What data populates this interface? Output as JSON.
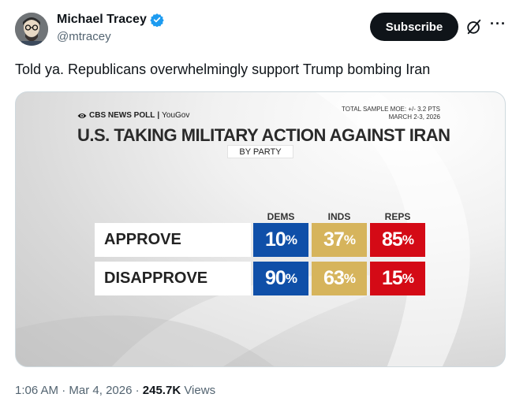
{
  "author": {
    "name": "Michael Tracey",
    "handle": "@mtracey",
    "verified": true,
    "avatar_icon": "avatar-caricature-icon"
  },
  "actions": {
    "subscribe_label": "Subscribe",
    "grok_icon": "grok-icon",
    "more_label": "···"
  },
  "tweet": {
    "text": "Told ya. Republicans overwhelmingly support Trump bombing Iran"
  },
  "poll_graphic": {
    "source": "CBS NEWS POLL",
    "partner": "YouGov",
    "moe_line1": "TOTAL SAMPLE MOE: +/- 3.2 PTS",
    "moe_line2": "MARCH 2-3, 2026",
    "title": "U.S. TAKING MILITARY ACTION AGAINST IRAN",
    "subtitle": "BY PARTY",
    "columns": [
      "DEMS",
      "INDS",
      "REPS"
    ],
    "column_colors": [
      "#0f4fa8",
      "#d6b45c",
      "#d40a16"
    ],
    "rows": [
      {
        "label": "APPROVE",
        "values": [
          "10",
          "37",
          "85"
        ]
      },
      {
        "label": "DISAPPROVE",
        "values": [
          "90",
          "63",
          "15"
        ]
      }
    ],
    "percent_sign": "%"
  },
  "chart_data": {
    "type": "table",
    "title": "U.S. TAKING MILITARY ACTION AGAINST IRAN",
    "subtitle": "BY PARTY",
    "categories": [
      "DEMS",
      "INDS",
      "REPS"
    ],
    "series": [
      {
        "name": "APPROVE",
        "values": [
          10,
          37,
          85
        ]
      },
      {
        "name": "DISAPPROVE",
        "values": [
          90,
          63,
          15
        ]
      }
    ]
  },
  "meta": {
    "time": "1:06 AM",
    "separator": "·",
    "date": "Mar 4, 2026",
    "views_count": "245.7K",
    "views_label": "Views"
  }
}
